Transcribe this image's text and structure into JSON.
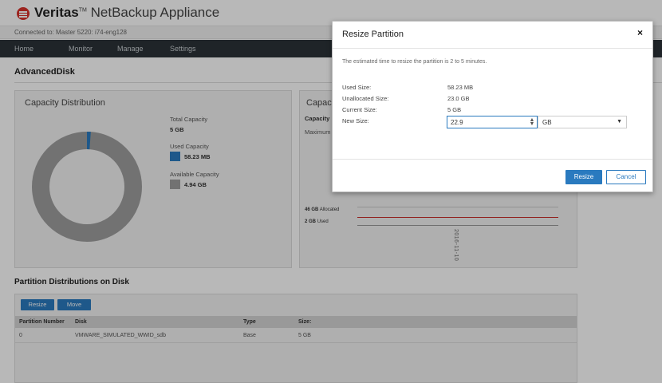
{
  "header": {
    "brand": "Veritas",
    "tm": "TM",
    "product": "NetBackup Appliance",
    "connected": "Connected to: Master 5220: i74-eng128"
  },
  "nav": {
    "items": [
      {
        "label": "Home"
      },
      {
        "label": "Monitor"
      },
      {
        "label": "Manage"
      },
      {
        "label": "Settings"
      }
    ]
  },
  "page": {
    "title": "AdvancedDisk"
  },
  "capacity": {
    "title": "Capacity Distribution",
    "total_label": "Total Capacity",
    "total_value": "5 GB",
    "used_label": "Used Capacity",
    "used_value": "58.23 MB",
    "available_label": "Available Capacity",
    "available_value": "4.94 GB",
    "used_fraction": 0.0114,
    "colors": {
      "used": "#2a7abf",
      "available": "#9e9e9e"
    }
  },
  "capacity2": {
    "title": "Capac",
    "sub": "Capacity",
    "max": "Maximum",
    "allocated_value": "46 GB",
    "allocated_label": "Allocated",
    "used_value": "2 GB",
    "used_label": "Used",
    "date": "2016-11-10"
  },
  "partitions": {
    "title": "Partition Distributions on Disk",
    "resize_label": "Resize",
    "move_label": "Move",
    "columns": [
      "Partition Number",
      "Disk",
      "Type",
      "Size:"
    ],
    "rows": [
      {
        "number": "0",
        "disk": "VMWARE_SIMULATED_WWID_sdb",
        "type": "Base",
        "size": "5 GB"
      }
    ]
  },
  "modal": {
    "title": "Resize Partition",
    "close": "×",
    "info": "The estimated time to resize the partition is 2 to 5 minutes.",
    "used_label": "Used Size:",
    "used_value": "58.23 MB",
    "unalloc_label": "Unallocated Size:",
    "unalloc_value": "23.0 GB",
    "current_label": "Current Size:",
    "current_value": "5 GB",
    "new_label": "New Size:",
    "new_value": "22.9",
    "unit": "GB",
    "resize_label": "Resize",
    "cancel_label": "Cancel"
  }
}
